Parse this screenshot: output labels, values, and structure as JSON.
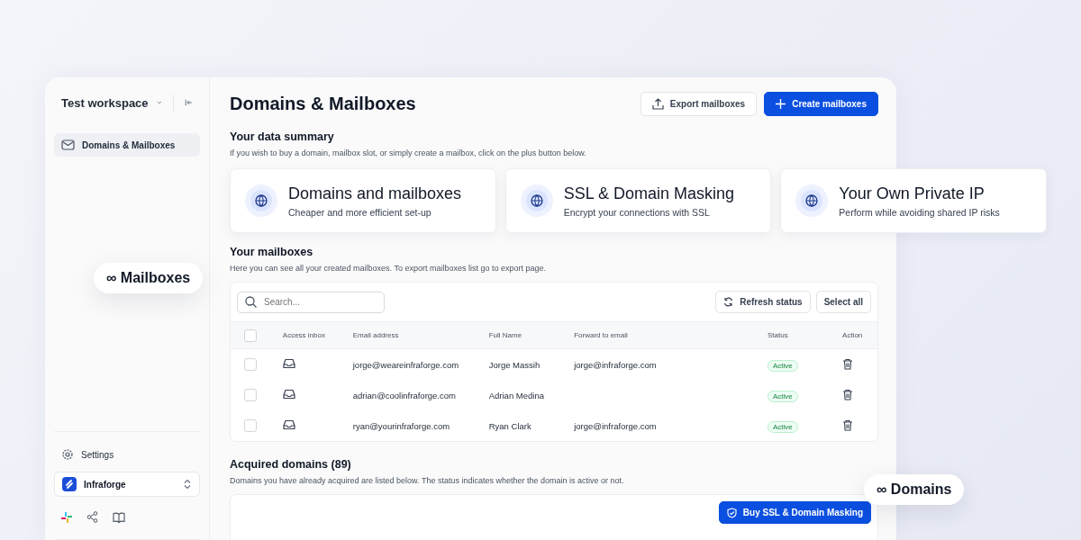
{
  "sidebar": {
    "workspace": "Test workspace",
    "nav_items": [
      {
        "label": "Domains & Mailboxes",
        "selected": true
      }
    ],
    "settings": "Settings",
    "org": "Infraforge"
  },
  "page": {
    "title": "Domains & Mailboxes",
    "buttons": [
      {
        "label": "Export mailboxes",
        "kind": "secondary"
      },
      {
        "label": "Create mailboxes",
        "kind": "primary"
      }
    ]
  },
  "summary": {
    "title": "Your data summary",
    "description": "If you wish to buy a domain, mailbox slot, or simply create a mailbox, click on the plus button below.",
    "cards": [
      {
        "title": "Domains and mailboxes",
        "subtitle": "Cheaper and more efficient set-up"
      },
      {
        "title": "SSL & Domain Masking",
        "subtitle": "Encrypt your connections with SSL"
      },
      {
        "title": "Your Own Private IP",
        "subtitle": "Perform while avoiding shared IP risks"
      }
    ]
  },
  "mailboxes": {
    "title": "Your mailboxes",
    "description": "Here you can see all your created mailboxes. To export mailboxes list go to export page.",
    "search": {
      "placeholder": "Search..."
    },
    "buttons": [
      {
        "label": "Refresh status",
        "kind": "refresh"
      },
      {
        "label": "Select all",
        "kind": "plain"
      }
    ],
    "all_checked": false,
    "columns": [
      "Access inbox",
      "Email address",
      "Full Name",
      "Forward to email",
      "Status",
      "Action"
    ],
    "rows": [
      {
        "checked": false,
        "email": "jorge@weareinfraforge.com",
        "name": "Jorge Massih",
        "forward": "jorge@infraforge.com",
        "status": "Active"
      },
      {
        "checked": false,
        "email": "adrian@coolinfraforge.com",
        "name": "Adrian Medina",
        "status": "Active"
      },
      {
        "checked": false,
        "email": "ryan@yourinfraforge.com",
        "name": "Ryan Clark",
        "forward": "jorge@infraforge.com",
        "status": "Active"
      }
    ]
  },
  "domains": {
    "title": "Acquired domains (89)",
    "description": "Domains you have already acquired are listed below. The status indicates whether the domain is active or not.",
    "button": "Buy SSL & Domain Masking"
  },
  "badges": [
    {
      "symbol": "∞",
      "label": "Mailboxes"
    },
    {
      "symbol": "∞",
      "label": "Domains"
    }
  ]
}
